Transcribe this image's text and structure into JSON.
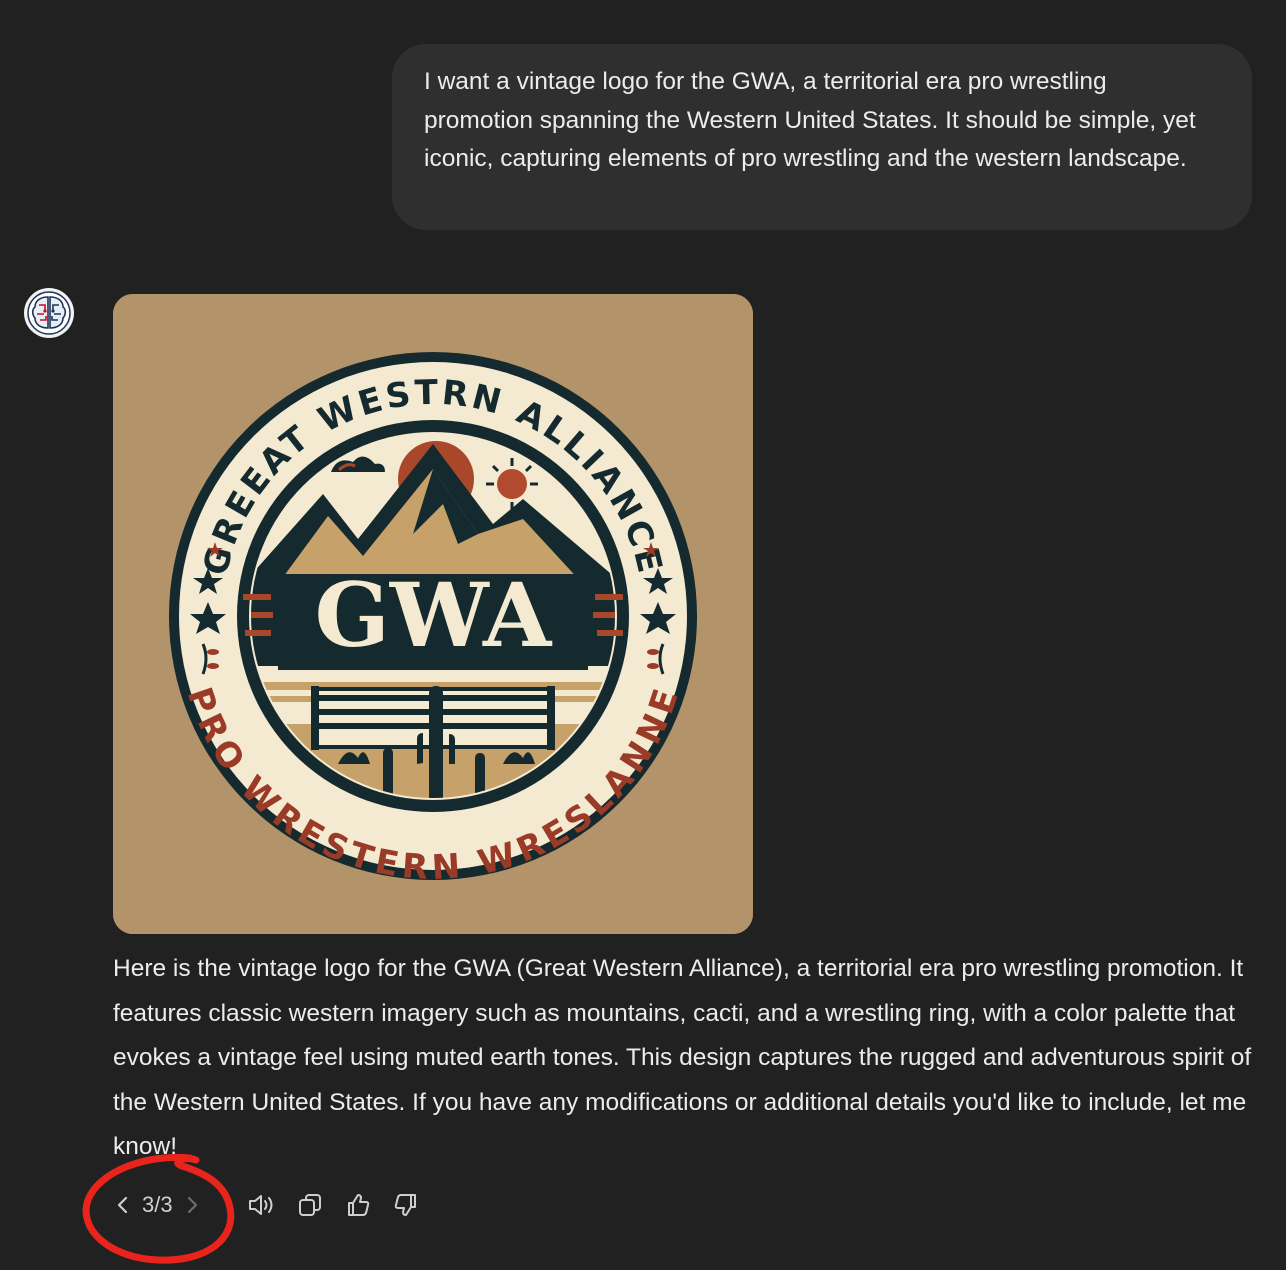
{
  "user_message": "I want a vintage logo for the GWA, a territorial era pro wrestling promotion spanning the Western United States. It should be simple, yet iconic, capturing elements of pro wrestling and the western landscape.",
  "assistant": {
    "avatar_icon": "brain-icon",
    "image": {
      "top_arc_text": "GREEAT WESTRN ALLIANCE",
      "bottom_arc_text": "PRO WRESTERN WRESLANNE",
      "center_text": "GWA",
      "colors": {
        "background": "#b3936a",
        "navy": "#142a2e",
        "cream": "#f4ead2",
        "rust": "#9a3b27",
        "tan": "#c7a16a",
        "sun": "#b14a2e"
      }
    },
    "response_text": "Here is the vintage logo for the GWA (Great Western Alliance), a territorial era pro wrestling promotion. It features classic western imagery such as mountains, cacti, and a wrestling ring, with a color palette that evokes a vintage feel using muted earth tones. This design captures the rugged and adventurous spirit of the Western United States. If you have any modifications or additional details you'd like to include, let me know!"
  },
  "actions": {
    "prev_icon": "chevron-left-icon",
    "counter": "3/3",
    "next_icon": "chevron-right-icon",
    "read_aloud_icon": "speaker-icon",
    "copy_icon": "copy-icon",
    "thumbs_up_icon": "thumbs-up-icon",
    "thumbs_down_icon": "thumbs-down-icon"
  },
  "annotation": {
    "color": "#e8241c"
  }
}
